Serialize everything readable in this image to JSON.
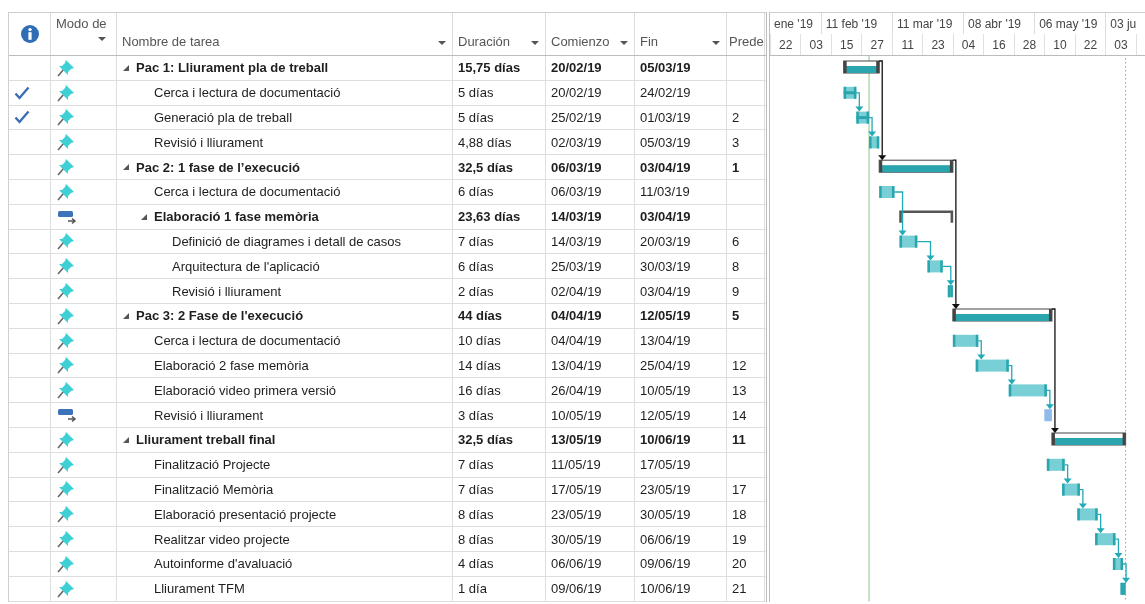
{
  "columns": [
    {
      "kind": "info"
    },
    {
      "kind": "text",
      "label": "Modo de",
      "filter": true
    },
    {
      "kind": "text",
      "label": "Nombre de tarea",
      "filter": true
    },
    {
      "kind": "text",
      "label": "Duración",
      "filter": true
    },
    {
      "kind": "text",
      "label": "Comienzo",
      "filter": true
    },
    {
      "kind": "text",
      "label": "Fin",
      "filter": true
    },
    {
      "kind": "text",
      "label": "Prede"
    }
  ],
  "tasks": [
    {
      "name": "Pac 1: Lliurament pla de treball",
      "duration": "15,75 días",
      "start": "20/02/19",
      "finish": "05/03/19",
      "done": false,
      "kind": "auto",
      "expanded": true,
      "children": [
        {
          "name": "Cerca i lectura de documentació",
          "duration": "5 días",
          "start": "20/02/19",
          "finish": "24/02/19",
          "done": true,
          "kind": "auto"
        },
        {
          "name": "Generació pla de treball",
          "duration": "5 días",
          "start": "25/02/19",
          "finish": "01/03/19",
          "predecessors": "2",
          "done": true,
          "kind": "auto"
        },
        {
          "name": "Revisió i lliurament",
          "duration": "4,88 días",
          "start": "02/03/19",
          "finish": "05/03/19",
          "predecessors": "3",
          "done": false,
          "kind": "auto"
        }
      ]
    },
    {
      "name": "Pac 2: 1 fase de l’execució",
      "duration": "32,5 días",
      "start": "06/03/19",
      "finish": "03/04/19",
      "predecessors": "1",
      "done": false,
      "kind": "auto",
      "expanded": true,
      "children": [
        {
          "name": "Cerca i lectura de documentació",
          "duration": "6 días",
          "start": "06/03/19",
          "finish": "11/03/19",
          "done": false,
          "kind": "auto"
        },
        {
          "name": "Elaboració 1 fase memòria",
          "duration": "23,63 días",
          "start": "14/03/19",
          "finish": "03/04/19",
          "done": false,
          "kind": "manual",
          "expanded": true,
          "children": [
            {
              "name": "Definició de diagrames i detall de casos",
              "duration": "7 días",
              "start": "14/03/19",
              "finish": "20/03/19",
              "predecessors": "6",
              "done": false,
              "kind": "auto"
            },
            {
              "name": "Arquitectura de l'aplicació",
              "duration": "6 días",
              "start": "25/03/19",
              "finish": "30/03/19",
              "predecessors": "8",
              "done": false,
              "kind": "auto"
            },
            {
              "name": "Revisió i lliurament",
              "duration": "2 días",
              "start": "02/04/19",
              "finish": "03/04/19",
              "predecessors": "9",
              "done": false,
              "kind": "auto"
            }
          ]
        }
      ]
    },
    {
      "name": "Pac 3: 2 Fase de l'execució",
      "duration": "44 días",
      "start": "04/04/19",
      "finish": "12/05/19",
      "predecessors": "5",
      "done": false,
      "kind": "auto",
      "expanded": true,
      "children": [
        {
          "name": "Cerca i lectura de documentació",
          "duration": "10 días",
          "start": "04/04/19",
          "finish": "13/04/19",
          "done": false,
          "kind": "auto"
        },
        {
          "name": "Elaboració 2 fase memòria",
          "duration": "14 días",
          "start": "13/04/19",
          "finish": "25/04/19",
          "predecessors": "12",
          "done": false,
          "kind": "auto"
        },
        {
          "name": "Elaboració video primera versió",
          "duration": "16 días",
          "start": "26/04/19",
          "finish": "10/05/19",
          "predecessors": "13",
          "done": false,
          "kind": "auto"
        },
        {
          "name": "Revisió i lliurament",
          "duration": "3 días",
          "start": "10/05/19",
          "finish": "12/05/19",
          "predecessors": "14",
          "done": false,
          "kind": "manual"
        }
      ]
    },
    {
      "name": "Lliurament treball final",
      "duration": "32,5 días",
      "start": "13/05/19",
      "finish": "10/06/19",
      "predecessors": "11",
      "done": false,
      "kind": "auto",
      "expanded": true,
      "children": [
        {
          "name": "Finalització Projecte",
          "duration": "7 días",
          "start": "11/05/19",
          "finish": "17/05/19",
          "done": false,
          "kind": "auto"
        },
        {
          "name": "Finalització Memòria",
          "duration": "7 días",
          "start": "17/05/19",
          "finish": "23/05/19",
          "predecessors": "17",
          "done": false,
          "kind": "auto"
        },
        {
          "name": "Elaboració presentació projecte",
          "duration": "8 días",
          "start": "23/05/19",
          "finish": "30/05/19",
          "predecessors": "18",
          "done": false,
          "kind": "auto"
        },
        {
          "name": "Realitzar video projecte",
          "duration": "8 días",
          "start": "30/05/19",
          "finish": "06/06/19",
          "predecessors": "19",
          "done": false,
          "kind": "auto"
        },
        {
          "name": "Autoinforme d'avaluació",
          "duration": "4 días",
          "start": "06/06/19",
          "finish": "09/06/19",
          "predecessors": "20",
          "done": false,
          "kind": "auto"
        },
        {
          "name": "Lliurament TFM",
          "duration": "1 día",
          "start": "09/06/19",
          "finish": "10/06/19",
          "predecessors": "21",
          "done": false,
          "kind": "auto"
        }
      ]
    }
  ],
  "timescale": {
    "major": [
      "ene '19",
      "11 feb '19",
      "11 mar '19",
      "08 abr '19",
      "06 may '19",
      "03 ju"
    ],
    "minor": [
      "22",
      "03",
      "15",
      "27",
      "11",
      "23",
      "04",
      "16",
      "28",
      "10",
      "22",
      "03"
    ]
  }
}
